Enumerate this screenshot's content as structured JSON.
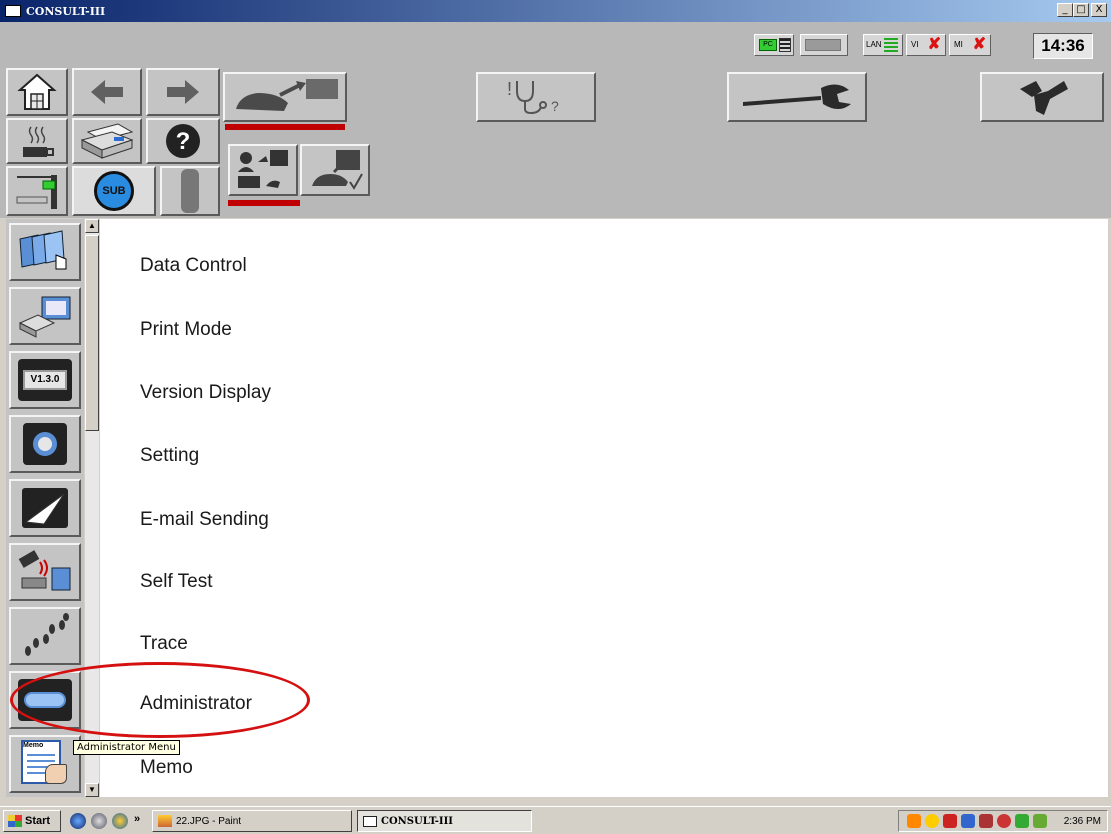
{
  "window": {
    "title": "CONSULT-III",
    "minimize": "_",
    "maximize": "□",
    "close": "X"
  },
  "status": {
    "pc_label": "PC",
    "lan_label": "LAN",
    "vi_label": "VI",
    "mi_label": "MI",
    "clock": "14:36"
  },
  "toolbar": {
    "sub_label": "SUB"
  },
  "sidebar": {
    "version_label": "V1.3.0",
    "memo_label": "Memo"
  },
  "menu": {
    "items": [
      {
        "label": "Data Control"
      },
      {
        "label": "Print Mode"
      },
      {
        "label": "Version Display"
      },
      {
        "label": "Setting"
      },
      {
        "label": "E-mail Sending"
      },
      {
        "label": "Self Test"
      },
      {
        "label": "Trace"
      },
      {
        "label": "Administrator"
      },
      {
        "label": "Memo"
      }
    ]
  },
  "tooltip": "Administrator Menu",
  "taskbar": {
    "start": "Start",
    "chevron": "»",
    "task_paint": "22.JPG - Paint",
    "task_consult": "CONSULT-III",
    "time": "2:36 PM"
  },
  "colors": {
    "title_start": "#0a246a",
    "title_end": "#a6caf0",
    "active_indicator": "#c00000",
    "annotation": "#d41010"
  }
}
